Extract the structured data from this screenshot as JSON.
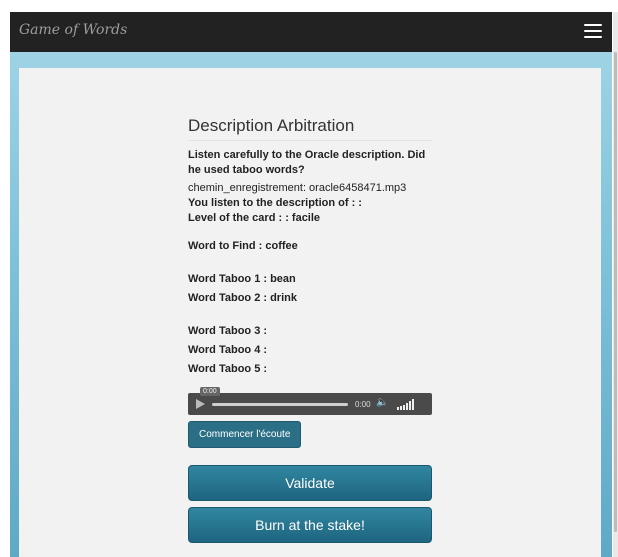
{
  "navbar": {
    "brand": "Game of Words",
    "menu_icon": "hamburger-icon"
  },
  "arbitration": {
    "title": "Description Arbitration",
    "instruction": "Listen carefully to the Oracle description. Did he used taboo words?",
    "recording_path": "chemin_enregistrement: oracle6458471.mp3",
    "listen_to": "You listen to the description of : :",
    "card_level": "Level of the card : : facile",
    "word_to_find": "Word to Find : coffee",
    "taboo_words": [
      "Word Taboo 1 : bean",
      "Word Taboo 2 : drink",
      "Word Taboo 3 :",
      "Word Taboo 4 :",
      "Word Taboo 5 :"
    ]
  },
  "player": {
    "tooltip_time": "0:00",
    "current_time": "0:00",
    "progress": 0
  },
  "buttons": {
    "start_listening": "Commencer l'écoute",
    "validate": "Validate",
    "burn": "Burn at the stake!"
  }
}
